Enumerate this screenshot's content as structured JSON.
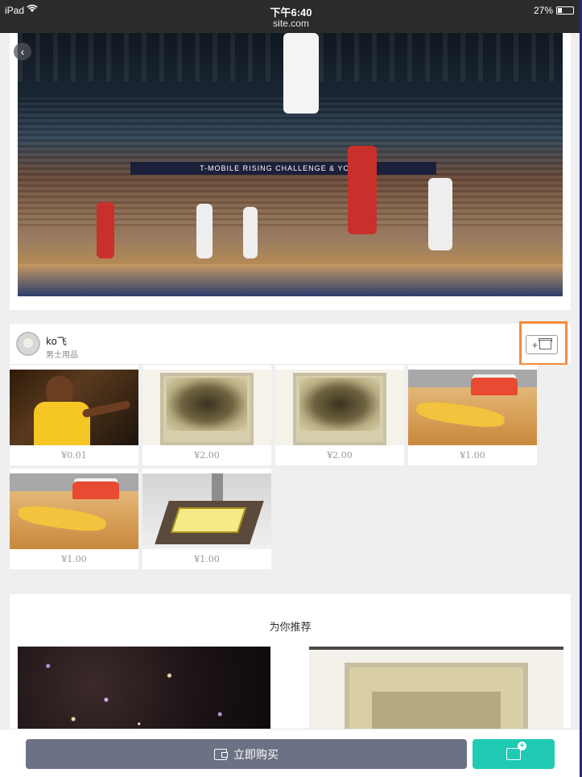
{
  "status_bar": {
    "device": "iPad",
    "wifi_icon": "wifi-icon",
    "time": "下午6:40",
    "host": "site.com",
    "battery": "27%"
  },
  "hero": {
    "banner_text": "T-MOBILE RISING CHALLENGE & YOUTH",
    "back_icon": "chevron-left-icon"
  },
  "seller": {
    "name": "ko飞",
    "category": "男士用品",
    "follow_label": "+",
    "follow_icon": "shop-icon"
  },
  "products": [
    {
      "price": "¥0.01",
      "image": "kobe"
    },
    {
      "price": "¥2.00",
      "image": "curtain"
    },
    {
      "price": "¥2.00",
      "image": "curtain"
    },
    {
      "price": "¥1.00",
      "image": "wood"
    },
    {
      "price": "¥1.00",
      "image": "wood"
    },
    {
      "price": "¥1.00",
      "image": "machine"
    }
  ],
  "recommend": {
    "title": "为你推荐"
  },
  "bottom_bar": {
    "buy_label": "立即购买",
    "buy_icon": "wallet-icon",
    "cart_icon": "add-to-cart-icon"
  },
  "colors": {
    "follow_highlight": "#f58a3c",
    "buy_button": "#6c7285",
    "cart_button": "#20cab3"
  }
}
